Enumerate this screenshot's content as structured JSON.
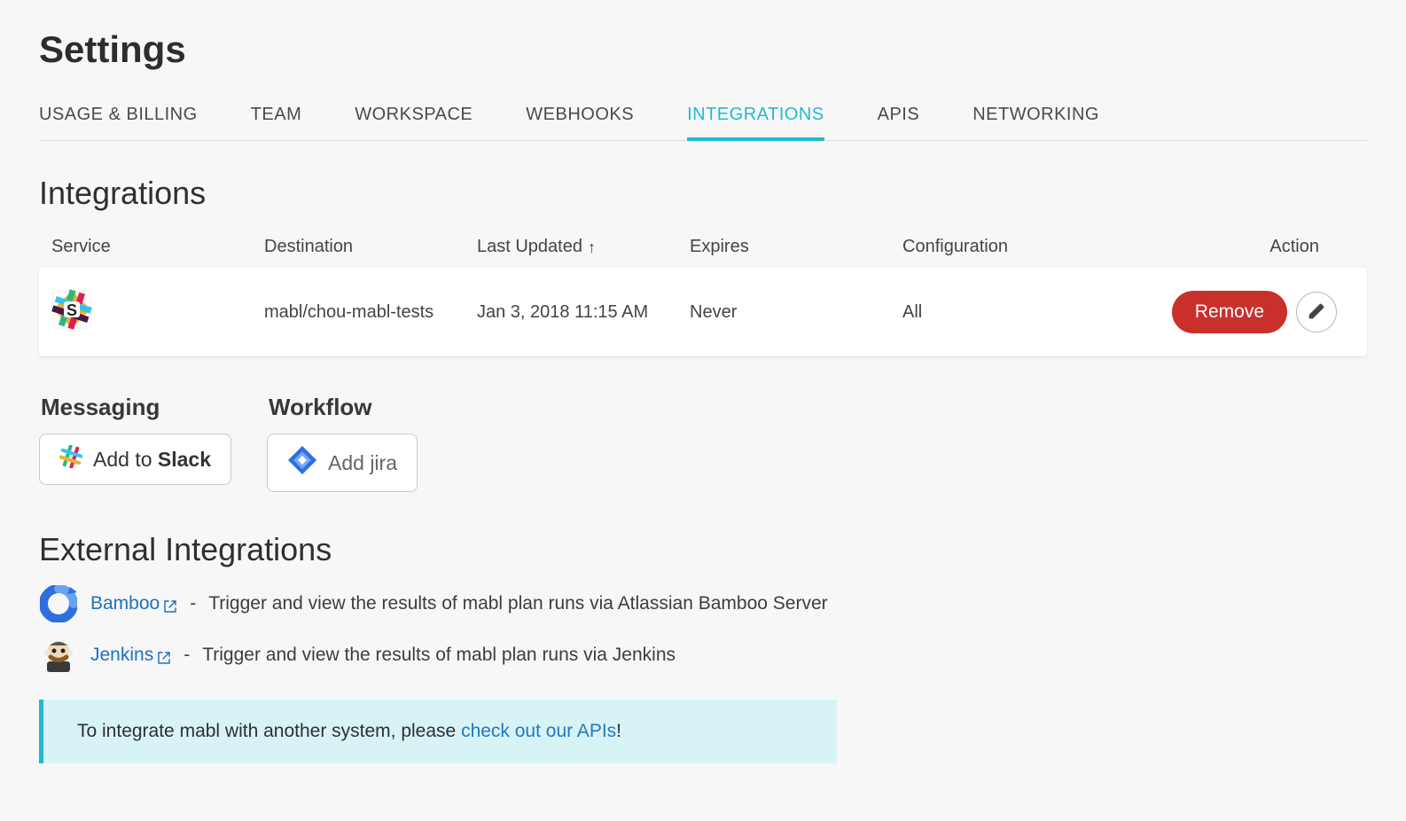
{
  "page": {
    "title": "Settings"
  },
  "tabs": [
    {
      "label": "USAGE & BILLING",
      "active": false,
      "key": "usage-billing"
    },
    {
      "label": "TEAM",
      "active": false,
      "key": "team"
    },
    {
      "label": "WORKSPACE",
      "active": false,
      "key": "workspace"
    },
    {
      "label": "WEBHOOKS",
      "active": false,
      "key": "webhooks"
    },
    {
      "label": "INTEGRATIONS",
      "active": true,
      "key": "integrations"
    },
    {
      "label": "APIS",
      "active": false,
      "key": "apis"
    },
    {
      "label": "NETWORKING",
      "active": false,
      "key": "networking"
    }
  ],
  "integrations": {
    "heading": "Integrations",
    "columns": {
      "service": "Service",
      "destination": "Destination",
      "last_updated": "Last Updated",
      "expires": "Expires",
      "configuration": "Configuration",
      "action": "Action"
    },
    "sort": {
      "column": "last_updated",
      "direction_glyph": "↑"
    },
    "rows": [
      {
        "service_icon": "slack-icon",
        "destination": "mabl/chou-mabl-tests",
        "last_updated": "Jan 3, 2018 11:15 AM",
        "expires": "Never",
        "configuration": "All",
        "remove_label": "Remove"
      }
    ]
  },
  "add": {
    "messaging_heading": "Messaging",
    "workflow_heading": "Workflow",
    "slack_prefix": "Add to ",
    "slack_strong": "Slack",
    "jira_label": "Add jira"
  },
  "external": {
    "heading": "External Integrations",
    "items": [
      {
        "icon": "bamboo-icon",
        "name": "Bamboo",
        "desc": "Trigger and view the results of mabl plan runs via Atlassian Bamboo Server"
      },
      {
        "icon": "jenkins-icon",
        "name": "Jenkins",
        "desc": "Trigger and view the results of mabl plan runs via Jenkins"
      }
    ]
  },
  "callout": {
    "text_before": "To integrate mabl with another system, please ",
    "link_text": "check out our APIs",
    "text_after": "!"
  }
}
